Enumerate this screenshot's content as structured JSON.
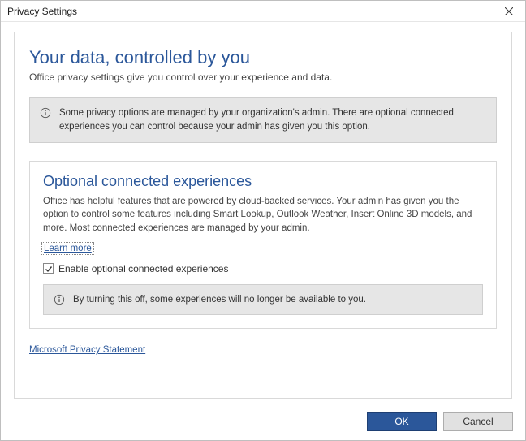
{
  "window": {
    "title": "Privacy Settings"
  },
  "main": {
    "heading": "Your data, controlled by you",
    "subhead": "Office privacy settings give you control over your experience and data.",
    "admin_notice": "Some privacy options are managed by your organization's admin. There are optional connected experiences you can control because your admin has given you this option."
  },
  "section": {
    "title": "Optional connected experiences",
    "body": "Office has helpful features that are powered by cloud-backed services. Your admin has given you the option to control some features including Smart Lookup, Outlook Weather, Insert Online 3D models, and more. Most connected experiences are managed by your admin.",
    "learn_more": "Learn more",
    "checkbox_label": "Enable optional connected experiences",
    "checkbox_checked": true,
    "off_warning": "By turning this off, some experiences will no longer be available to you."
  },
  "links": {
    "privacy_statement": "Microsoft Privacy Statement"
  },
  "buttons": {
    "ok": "OK",
    "cancel": "Cancel"
  }
}
